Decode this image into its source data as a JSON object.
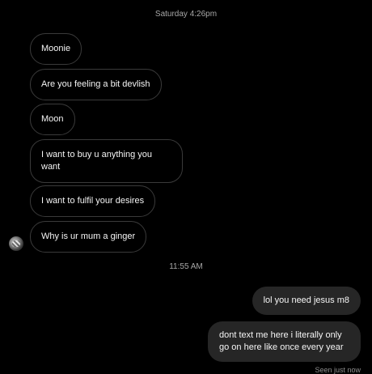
{
  "thread": {
    "timestamp_1": "Saturday 4:26pm",
    "timestamp_2": "11:55 AM",
    "incoming": [
      "Moonie",
      "Are you feeling a bit devlish",
      "Moon",
      "I want to buy u anything you want",
      "I want to fulfil your desires",
      "Why is ur mum a ginger"
    ],
    "outgoing": [
      "lol you need jesus m8",
      "dont text me here i literally only go on here like once every year"
    ],
    "seen_status": "Seen just now"
  },
  "icons": {
    "avatar": "sender-avatar-icon"
  },
  "colors": {
    "background": "#000000",
    "incoming_border": "#3a3a3a",
    "outgoing_bubble": "#262626",
    "text": "#f5f5f5",
    "meta_text": "#a8a8a8"
  }
}
